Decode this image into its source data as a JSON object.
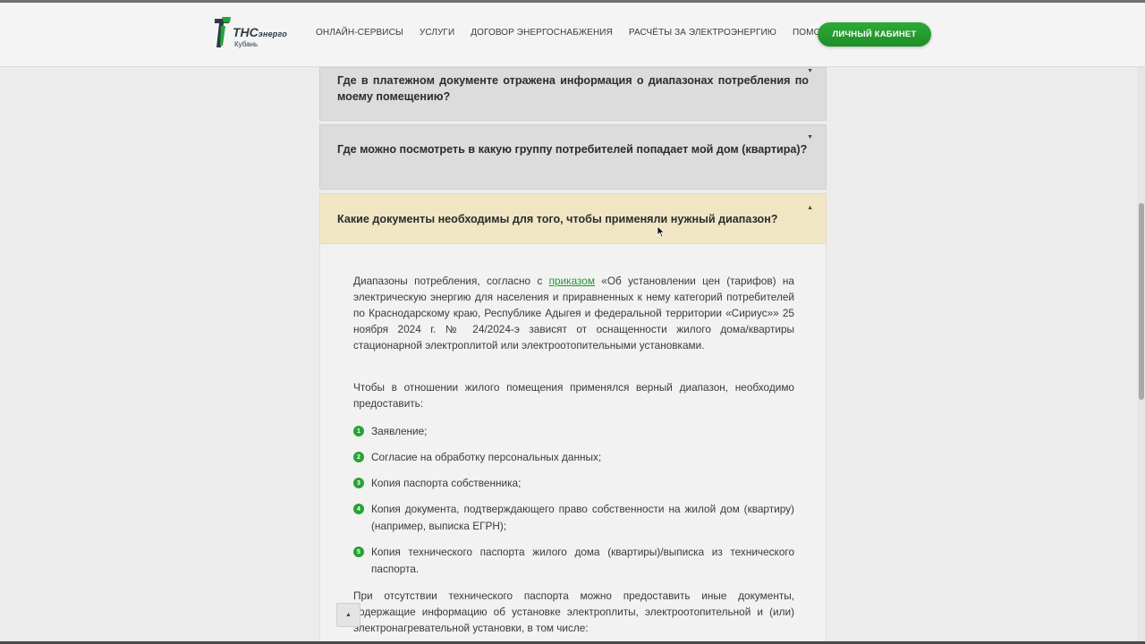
{
  "header": {
    "logo": {
      "brand": "ТНС",
      "brand_small": "энерго",
      "region": "Кубань"
    },
    "nav": [
      {
        "label": "ОНЛАЙН-СЕРВИСЫ"
      },
      {
        "label": "УСЛУГИ"
      },
      {
        "label": "ДОГОВОР ЭНЕРГОСНАБЖЕНИЯ"
      },
      {
        "label": "РАСЧЁТЫ ЗА ЭЛЕКТРОЭНЕРГИЮ"
      },
      {
        "label": "ПОМОЩЬ"
      }
    ],
    "cabinet_button": "ЛИЧНЫЙ КАБИНЕТ"
  },
  "faq": [
    {
      "question": "Где в платежном документе отражена информация о диапазонах потребления по моему помещению?",
      "expanded": false
    },
    {
      "question": "Где можно посмотреть в какую группу потребителей попадает мой дом (квартира)?",
      "expanded": false
    },
    {
      "question": "Какие документы необходимы для того, чтобы применяли нужный диапазон?",
      "expanded": true
    }
  ],
  "answer": {
    "p1_before_link": "Диапазоны потребления, согласно с ",
    "p1_link": "приказом",
    "p1_after_link": " «Об установлении цен (тарифов) на электрическую энергию для населения и приравненных к нему категорий потребителей по Краснодарскому краю, Республике Адыгея и федеральной территории «Сириус»» 25 ноября 2024 г. № 24/2024-э зависят от оснащенности жилого дома/квартиры стационарной электроплитой или электроотопительными установками.",
    "p2": "Чтобы в отношении жилого помещения применялся верный диапазон, необходимо предоставить:",
    "list": [
      {
        "num": "1",
        "text": "Заявление;"
      },
      {
        "num": "2",
        "text": "Согласие на обработку персональных данных;"
      },
      {
        "num": "3",
        "text": "Копия паспорта собственника;"
      },
      {
        "num": "4",
        "text": "Копия документа, подтверждающего право собственности на жилой дом (квартиру) (например, выписка ЕГРН);"
      },
      {
        "num": "5",
        "text": "Копия технического паспорта жилого дома (квартиры)/выписка из технического паспорта."
      }
    ],
    "p3": "При отсутствии технического паспорта можно предоставить иные документы, содержащие информацию об установке электроплиты, электроотопительной и (или) электронагревательной установки, в том числе:"
  },
  "colors": {
    "accent_green": "#27a236",
    "open_item_bg": "#f0e6c4",
    "collapsed_item_bg": "#dcdcdc"
  },
  "icons": {
    "expand": "caret-down-icon",
    "collapse": "caret-up-icon",
    "scroll_top": "arrow-up-icon"
  }
}
